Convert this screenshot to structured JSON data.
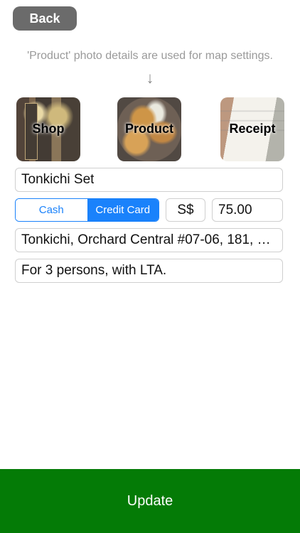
{
  "header": {
    "back_label": "Back"
  },
  "hint": {
    "text": "'Product' photo details are used for map settings.",
    "arrow": "↓"
  },
  "photos": [
    {
      "label": "Shop"
    },
    {
      "label": "Product"
    },
    {
      "label": "Receipt"
    }
  ],
  "form": {
    "name_value": "Tonkichi Set",
    "payment_options": [
      "Cash",
      "Credit Card"
    ],
    "payment_selected": "Credit Card",
    "currency": "S$",
    "amount_value": "75.00",
    "address_value": "Tonkichi, Orchard Central #07-06, 181, O...",
    "note_value": "For 3 persons, with LTA."
  },
  "footer": {
    "update_label": "Update"
  },
  "colors": {
    "accent": "#1a82fb",
    "update_bg": "#047b06",
    "back_bg": "#6b6b6b"
  }
}
